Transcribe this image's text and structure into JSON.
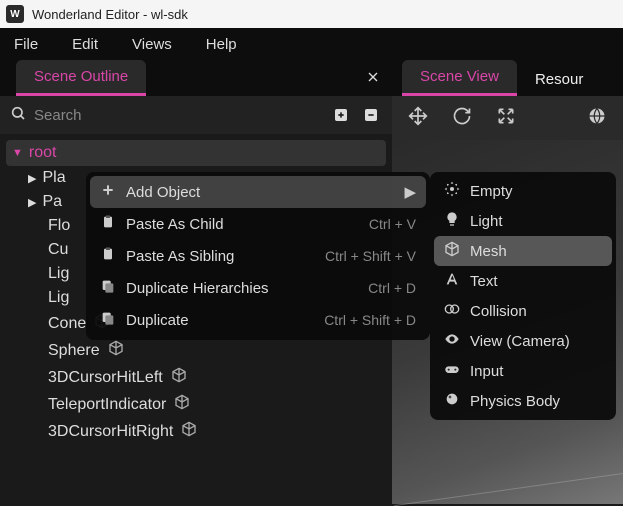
{
  "app": {
    "title": "Wonderland Editor - wl-sdk",
    "icon_letter": "W"
  },
  "menu": {
    "items": [
      "File",
      "Edit",
      "Views",
      "Help"
    ]
  },
  "left_tab": {
    "label": "Scene Outline"
  },
  "right_tabs": {
    "view": "Scene View",
    "resources": "Resour"
  },
  "search": {
    "placeholder": "Search"
  },
  "tree": {
    "root": "root",
    "items": [
      {
        "label": "Pla",
        "has_children": true
      },
      {
        "label": "Pa",
        "has_children": true
      },
      {
        "label": "Flo",
        "has_children": false
      },
      {
        "label": "Cu",
        "has_children": false
      },
      {
        "label": "Lig",
        "has_children": false
      },
      {
        "label": "Lig",
        "has_children": false
      },
      {
        "label": "Cone",
        "has_cube": true
      },
      {
        "label": "Sphere",
        "has_cube": true
      },
      {
        "label": "3DCursorHitLeft",
        "has_cube": true
      },
      {
        "label": "TeleportIndicator",
        "has_cube": true
      },
      {
        "label": "3DCursorHitRight",
        "has_cube": true
      }
    ]
  },
  "context_menu": {
    "items": [
      {
        "icon": "plus",
        "label": "Add Object",
        "arrow": true,
        "highlight": true
      },
      {
        "icon": "paste",
        "label": "Paste As Child",
        "shortcut": "Ctrl + V"
      },
      {
        "icon": "paste",
        "label": "Paste As Sibling",
        "shortcut": "Ctrl + Shift + V"
      },
      {
        "icon": "copy",
        "label": "Duplicate Hierarchies",
        "shortcut": "Ctrl + D"
      },
      {
        "icon": "copy",
        "label": "Duplicate",
        "shortcut": "Ctrl + Shift + D"
      }
    ]
  },
  "submenu": {
    "items": [
      {
        "icon": "gear",
        "label": "Empty"
      },
      {
        "icon": "bulb",
        "label": "Light"
      },
      {
        "icon": "cube",
        "label": "Mesh",
        "highlight": true
      },
      {
        "icon": "text",
        "label": "Text"
      },
      {
        "icon": "collision",
        "label": "Collision"
      },
      {
        "icon": "eye",
        "label": "View (Camera)"
      },
      {
        "icon": "gamepad",
        "label": "Input"
      },
      {
        "icon": "physics",
        "label": "Physics Body"
      }
    ]
  }
}
